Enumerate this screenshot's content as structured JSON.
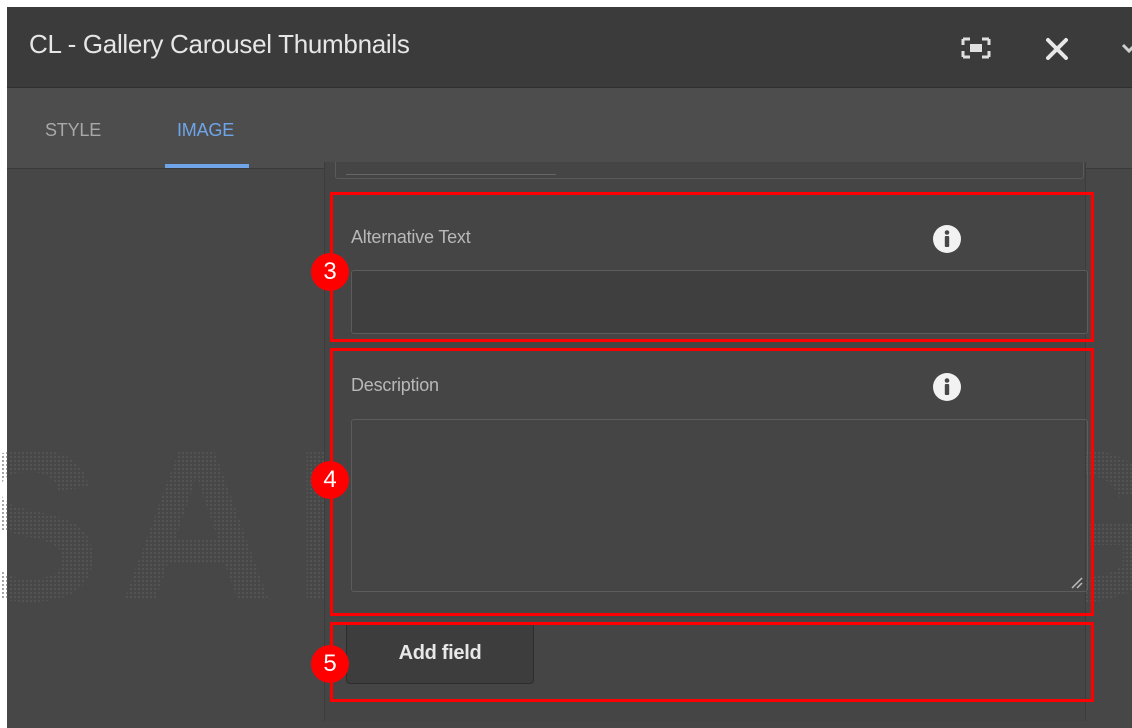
{
  "dialog": {
    "title": "CL - Gallery Carousel Thumbnails",
    "icons": {
      "fullscreen": "fullscreen-toggle-icon",
      "close": "close-icon",
      "collapse": "chevron-down-icon"
    }
  },
  "tabs": [
    {
      "label": "STYLE",
      "selected": false
    },
    {
      "label": "IMAGE",
      "selected": true
    }
  ],
  "fields": {
    "alt_text": {
      "label": "Alternative Text",
      "value": "",
      "info_icon": "info-icon"
    },
    "description": {
      "label": "Description",
      "value": "",
      "info_icon": "info-icon"
    }
  },
  "add_field_label": "Add field",
  "watermark": "SAMSUNG",
  "annotations": [
    "3",
    "4",
    "5"
  ],
  "colors": {
    "titlebar_bg": "#3b3b3b",
    "panel_bg": "#474747",
    "tab_active": "#6fa5e8",
    "callout": "#ff0000"
  }
}
